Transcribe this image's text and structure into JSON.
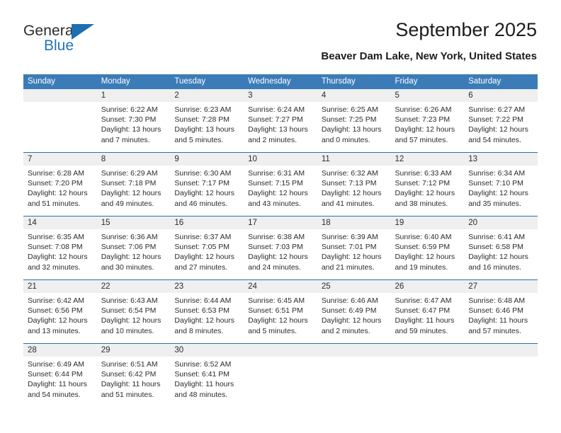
{
  "brand": {
    "name_top": "General",
    "name_bottom": "Blue",
    "accent_color": "#1c6fb0"
  },
  "header": {
    "title": "September 2025",
    "subtitle": "Beaver Dam Lake, New York, United States"
  },
  "calendar": {
    "header_bg": "#3b7cb8",
    "daterow_bg": "#efefef",
    "rule_color": "#2f6fa8",
    "weekdays": [
      "Sunday",
      "Monday",
      "Tuesday",
      "Wednesday",
      "Thursday",
      "Friday",
      "Saturday"
    ],
    "weeks": [
      [
        {
          "day": "",
          "sunrise": "",
          "sunset": "",
          "daylight_1": "",
          "daylight_2": ""
        },
        {
          "day": "1",
          "sunrise": "Sunrise: 6:22 AM",
          "sunset": "Sunset: 7:30 PM",
          "daylight_1": "Daylight: 13 hours",
          "daylight_2": "and 7 minutes."
        },
        {
          "day": "2",
          "sunrise": "Sunrise: 6:23 AM",
          "sunset": "Sunset: 7:28 PM",
          "daylight_1": "Daylight: 13 hours",
          "daylight_2": "and 5 minutes."
        },
        {
          "day": "3",
          "sunrise": "Sunrise: 6:24 AM",
          "sunset": "Sunset: 7:27 PM",
          "daylight_1": "Daylight: 13 hours",
          "daylight_2": "and 2 minutes."
        },
        {
          "day": "4",
          "sunrise": "Sunrise: 6:25 AM",
          "sunset": "Sunset: 7:25 PM",
          "daylight_1": "Daylight: 13 hours",
          "daylight_2": "and 0 minutes."
        },
        {
          "day": "5",
          "sunrise": "Sunrise: 6:26 AM",
          "sunset": "Sunset: 7:23 PM",
          "daylight_1": "Daylight: 12 hours",
          "daylight_2": "and 57 minutes."
        },
        {
          "day": "6",
          "sunrise": "Sunrise: 6:27 AM",
          "sunset": "Sunset: 7:22 PM",
          "daylight_1": "Daylight: 12 hours",
          "daylight_2": "and 54 minutes."
        }
      ],
      [
        {
          "day": "7",
          "sunrise": "Sunrise: 6:28 AM",
          "sunset": "Sunset: 7:20 PM",
          "daylight_1": "Daylight: 12 hours",
          "daylight_2": "and 51 minutes."
        },
        {
          "day": "8",
          "sunrise": "Sunrise: 6:29 AM",
          "sunset": "Sunset: 7:18 PM",
          "daylight_1": "Daylight: 12 hours",
          "daylight_2": "and 49 minutes."
        },
        {
          "day": "9",
          "sunrise": "Sunrise: 6:30 AM",
          "sunset": "Sunset: 7:17 PM",
          "daylight_1": "Daylight: 12 hours",
          "daylight_2": "and 46 minutes."
        },
        {
          "day": "10",
          "sunrise": "Sunrise: 6:31 AM",
          "sunset": "Sunset: 7:15 PM",
          "daylight_1": "Daylight: 12 hours",
          "daylight_2": "and 43 minutes."
        },
        {
          "day": "11",
          "sunrise": "Sunrise: 6:32 AM",
          "sunset": "Sunset: 7:13 PM",
          "daylight_1": "Daylight: 12 hours",
          "daylight_2": "and 41 minutes."
        },
        {
          "day": "12",
          "sunrise": "Sunrise: 6:33 AM",
          "sunset": "Sunset: 7:12 PM",
          "daylight_1": "Daylight: 12 hours",
          "daylight_2": "and 38 minutes."
        },
        {
          "day": "13",
          "sunrise": "Sunrise: 6:34 AM",
          "sunset": "Sunset: 7:10 PM",
          "daylight_1": "Daylight: 12 hours",
          "daylight_2": "and 35 minutes."
        }
      ],
      [
        {
          "day": "14",
          "sunrise": "Sunrise: 6:35 AM",
          "sunset": "Sunset: 7:08 PM",
          "daylight_1": "Daylight: 12 hours",
          "daylight_2": "and 32 minutes."
        },
        {
          "day": "15",
          "sunrise": "Sunrise: 6:36 AM",
          "sunset": "Sunset: 7:06 PM",
          "daylight_1": "Daylight: 12 hours",
          "daylight_2": "and 30 minutes."
        },
        {
          "day": "16",
          "sunrise": "Sunrise: 6:37 AM",
          "sunset": "Sunset: 7:05 PM",
          "daylight_1": "Daylight: 12 hours",
          "daylight_2": "and 27 minutes."
        },
        {
          "day": "17",
          "sunrise": "Sunrise: 6:38 AM",
          "sunset": "Sunset: 7:03 PM",
          "daylight_1": "Daylight: 12 hours",
          "daylight_2": "and 24 minutes."
        },
        {
          "day": "18",
          "sunrise": "Sunrise: 6:39 AM",
          "sunset": "Sunset: 7:01 PM",
          "daylight_1": "Daylight: 12 hours",
          "daylight_2": "and 21 minutes."
        },
        {
          "day": "19",
          "sunrise": "Sunrise: 6:40 AM",
          "sunset": "Sunset: 6:59 PM",
          "daylight_1": "Daylight: 12 hours",
          "daylight_2": "and 19 minutes."
        },
        {
          "day": "20",
          "sunrise": "Sunrise: 6:41 AM",
          "sunset": "Sunset: 6:58 PM",
          "daylight_1": "Daylight: 12 hours",
          "daylight_2": "and 16 minutes."
        }
      ],
      [
        {
          "day": "21",
          "sunrise": "Sunrise: 6:42 AM",
          "sunset": "Sunset: 6:56 PM",
          "daylight_1": "Daylight: 12 hours",
          "daylight_2": "and 13 minutes."
        },
        {
          "day": "22",
          "sunrise": "Sunrise: 6:43 AM",
          "sunset": "Sunset: 6:54 PM",
          "daylight_1": "Daylight: 12 hours",
          "daylight_2": "and 10 minutes."
        },
        {
          "day": "23",
          "sunrise": "Sunrise: 6:44 AM",
          "sunset": "Sunset: 6:53 PM",
          "daylight_1": "Daylight: 12 hours",
          "daylight_2": "and 8 minutes."
        },
        {
          "day": "24",
          "sunrise": "Sunrise: 6:45 AM",
          "sunset": "Sunset: 6:51 PM",
          "daylight_1": "Daylight: 12 hours",
          "daylight_2": "and 5 minutes."
        },
        {
          "day": "25",
          "sunrise": "Sunrise: 6:46 AM",
          "sunset": "Sunset: 6:49 PM",
          "daylight_1": "Daylight: 12 hours",
          "daylight_2": "and 2 minutes."
        },
        {
          "day": "26",
          "sunrise": "Sunrise: 6:47 AM",
          "sunset": "Sunset: 6:47 PM",
          "daylight_1": "Daylight: 11 hours",
          "daylight_2": "and 59 minutes."
        },
        {
          "day": "27",
          "sunrise": "Sunrise: 6:48 AM",
          "sunset": "Sunset: 6:46 PM",
          "daylight_1": "Daylight: 11 hours",
          "daylight_2": "and 57 minutes."
        }
      ],
      [
        {
          "day": "28",
          "sunrise": "Sunrise: 6:49 AM",
          "sunset": "Sunset: 6:44 PM",
          "daylight_1": "Daylight: 11 hours",
          "daylight_2": "and 54 minutes."
        },
        {
          "day": "29",
          "sunrise": "Sunrise: 6:51 AM",
          "sunset": "Sunset: 6:42 PM",
          "daylight_1": "Daylight: 11 hours",
          "daylight_2": "and 51 minutes."
        },
        {
          "day": "30",
          "sunrise": "Sunrise: 6:52 AM",
          "sunset": "Sunset: 6:41 PM",
          "daylight_1": "Daylight: 11 hours",
          "daylight_2": "and 48 minutes."
        },
        {
          "day": "",
          "sunrise": "",
          "sunset": "",
          "daylight_1": "",
          "daylight_2": ""
        },
        {
          "day": "",
          "sunrise": "",
          "sunset": "",
          "daylight_1": "",
          "daylight_2": ""
        },
        {
          "day": "",
          "sunrise": "",
          "sunset": "",
          "daylight_1": "",
          "daylight_2": ""
        },
        {
          "day": "",
          "sunrise": "",
          "sunset": "",
          "daylight_1": "",
          "daylight_2": ""
        }
      ]
    ]
  }
}
